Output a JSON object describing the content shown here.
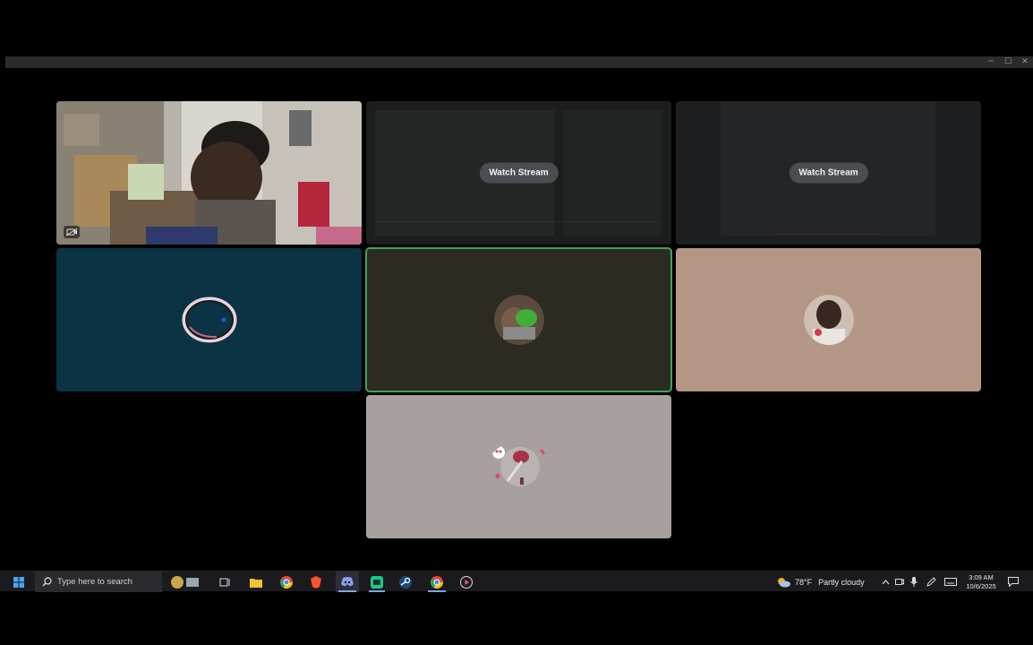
{
  "window": {
    "controls": {
      "minimize_icon": "─",
      "maximize_icon": "☐",
      "close_icon": "✕"
    }
  },
  "call": {
    "tiles": [
      {
        "kind": "camera",
        "camera_icon": "camera-off-icon"
      },
      {
        "kind": "stream",
        "button_label": "Watch Stream"
      },
      {
        "kind": "stream",
        "button_label": "Watch Stream"
      },
      {
        "kind": "avatar",
        "bg": "#0b3344",
        "speaking": false
      },
      {
        "kind": "avatar",
        "bg": "#2d2a22",
        "speaking": true
      },
      {
        "kind": "avatar",
        "bg": "#b39684",
        "speaking": false
      },
      {
        "kind": "avatar",
        "bg": "#a6a09f",
        "speaking": false
      }
    ],
    "speaking_color": "#3ba55d"
  },
  "taskbar": {
    "search_placeholder": "Type here to search",
    "weather": {
      "temp": "78°F",
      "condition": "Partly cloudy"
    },
    "clock": {
      "time": "3:09 AM",
      "date": "10/6/2025"
    },
    "pinned": [
      "search-widget",
      "task-view",
      "file-explorer",
      "chrome",
      "brave",
      "discord",
      "app-green",
      "steam",
      "chrome-profile",
      "media-player"
    ]
  }
}
